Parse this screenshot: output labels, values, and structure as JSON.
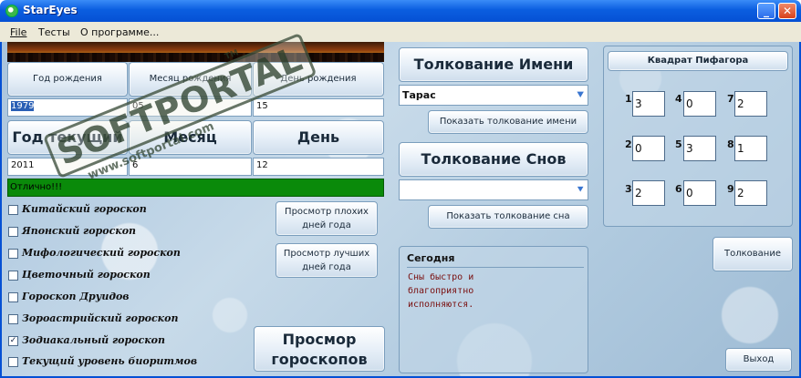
{
  "window": {
    "title": "StarEyes",
    "min_glyph": "_",
    "close_glyph": "✕"
  },
  "menu": {
    "file": "File",
    "tests": "Тесты",
    "about": "О программе..."
  },
  "birth": {
    "year_label": "Год рождения",
    "month_label": "Месяц рождения",
    "day_label": "День рождения",
    "year_value": "1979",
    "month_value": "05",
    "day_value": "15"
  },
  "current": {
    "year_label": "Год текущий",
    "month_label": "Месяц",
    "day_label": "День",
    "year_value": "2011",
    "month_value": "6",
    "day_value": "12"
  },
  "status": {
    "text": "Отлично!!!",
    "color": "#0a8a0a"
  },
  "horoscopes": [
    {
      "label": "Китайский гороскоп",
      "checked": false
    },
    {
      "label": "Японский гороскоп",
      "checked": false
    },
    {
      "label": "Мифологический гороскоп",
      "checked": false
    },
    {
      "label": "Цветочный гороскоп",
      "checked": false
    },
    {
      "label": "Гороскоп Друидов",
      "checked": false
    },
    {
      "label": "Зороастрийский гороскоп",
      "checked": false
    },
    {
      "label": "Зодиакальный гороскоп",
      "checked": true
    },
    {
      "label": "Текущий уровень биоритмов",
      "checked": false
    }
  ],
  "days": {
    "bad_line1": "Просмотр плохих",
    "bad_line2": "дней года",
    "good_line1": "Просмотр лучших",
    "good_line2": "дней года"
  },
  "view_horoscopes": {
    "line1": "Просмор",
    "line2": "гороскопов"
  },
  "name_section": {
    "header": "Толкование Имени",
    "value": "Тарас",
    "show_button": "Показать толкование имени"
  },
  "dream_section": {
    "header": "Толкование Снов",
    "value": "",
    "show_button": "Показать толкование сна"
  },
  "today": {
    "label": "Сегодня",
    "text": "Сны быстро и благоприятно исполняются."
  },
  "pythagoras": {
    "title": "Квадрат Пифагора",
    "cells": [
      {
        "label": "1",
        "value": "3"
      },
      {
        "label": "4",
        "value": "0"
      },
      {
        "label": "7",
        "value": "2"
      },
      {
        "label": "2",
        "value": "0"
      },
      {
        "label": "5",
        "value": "3"
      },
      {
        "label": "8",
        "value": "1"
      },
      {
        "label": "3",
        "value": "2"
      },
      {
        "label": "6",
        "value": "0"
      },
      {
        "label": "9",
        "value": "2"
      }
    ],
    "interpret_button": "Толкование"
  },
  "exit_button": "Выход",
  "watermark": {
    "main": "SOFTPORTAL",
    "sub": "www.softportal.com",
    "tm": "TM"
  }
}
